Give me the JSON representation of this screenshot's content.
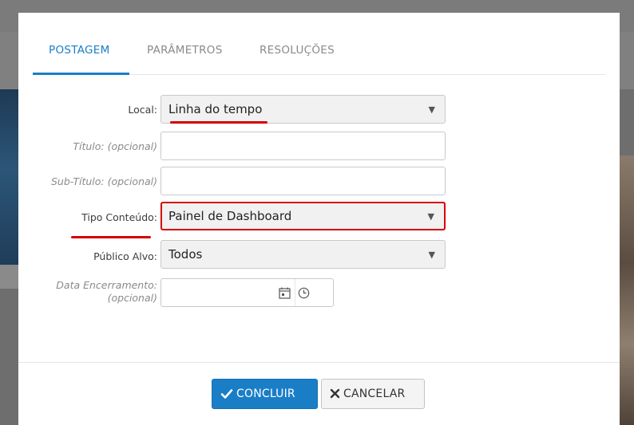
{
  "tabs": [
    {
      "label": "POSTAGEM",
      "active": true
    },
    {
      "label": "PARÂMETROS",
      "active": false
    },
    {
      "label": "RESOLUÇÕES",
      "active": false
    }
  ],
  "form": {
    "local": {
      "label": "Local:",
      "value": "Linha do tempo"
    },
    "titulo": {
      "label": "Título: (opcional)",
      "value": ""
    },
    "subtitulo": {
      "label": "Sub-Título: (opcional)",
      "value": ""
    },
    "tipo_conteudo": {
      "label": "Tipo Conteúdo:",
      "value": "Painel de Dashboard"
    },
    "publico_alvo": {
      "label": "Público Alvo:",
      "value": "Todos"
    },
    "data_encerramento": {
      "label_line1": "Data Encerramento:",
      "label_line2": "(opcional)",
      "value": ""
    }
  },
  "buttons": {
    "concluir": "CONCLUIR",
    "cancelar": "CANCELAR"
  },
  "colors": {
    "accent": "#1a7ec7",
    "highlight": "#d40000"
  },
  "icons": [
    "calendar-icon",
    "clock-icon",
    "check-icon",
    "x-icon",
    "caret-down-icon"
  ]
}
